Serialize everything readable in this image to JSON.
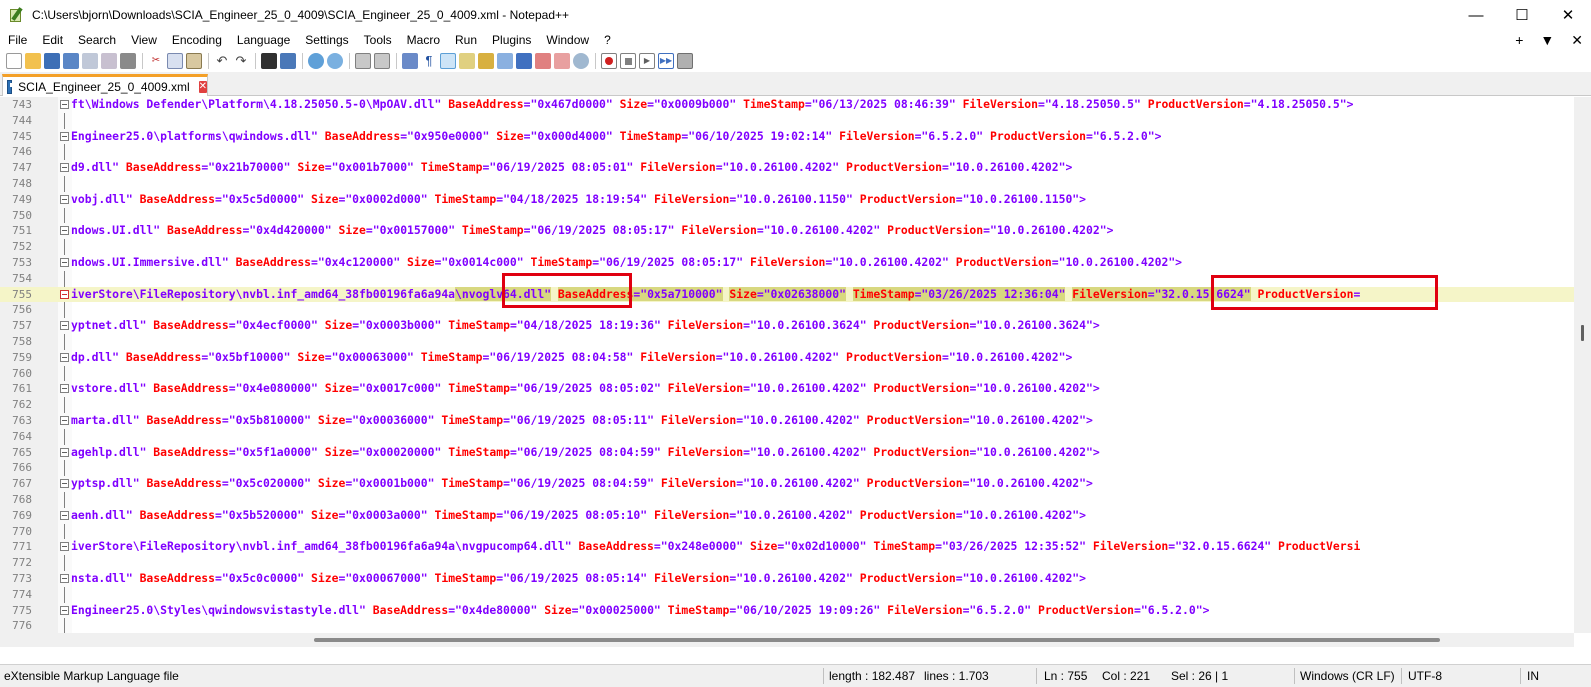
{
  "window": {
    "title": "C:\\Users\\bjorn\\Downloads\\SCIA_Engineer_25_0_4009\\SCIA_Engineer_25_0_4009.xml - Notepad++",
    "minimize": "—",
    "maximize": "☐",
    "close": "✕"
  },
  "menu": {
    "items": [
      "File",
      "Edit",
      "Search",
      "View",
      "Encoding",
      "Language",
      "Settings",
      "Tools",
      "Macro",
      "Run",
      "Plugins",
      "Window",
      "?"
    ],
    "right": [
      "+",
      "▼",
      "✕"
    ]
  },
  "toolbar": {
    "icons": [
      "new-file-icon",
      "open-file-icon",
      "save-icon",
      "save-all-icon",
      "close-icon",
      "close-all-icon",
      "print-icon",
      "cut-icon",
      "copy-icon",
      "paste-icon",
      "undo-icon",
      "redo-icon",
      "find-icon",
      "replace-icon",
      "zoom-in-icon",
      "zoom-out-icon",
      "sync-vertical-icon",
      "sync-horizontal-icon",
      "word-wrap-icon",
      "show-all-chars-icon",
      "indent-guide-icon",
      "udl-icon",
      "document-map-icon",
      "function-list-icon",
      "folder-workspace-icon",
      "monitoring-icon",
      "record-macro-icon",
      "stop-macro-icon",
      "play-macro-icon",
      "run-macro-multiple-icon",
      "save-macro-icon"
    ],
    "colors": {
      "active_bg": "#cde4f7"
    }
  },
  "tab": {
    "label": "SCIA_Engineer_25_0_4009.xml",
    "accent": "#f4a028"
  },
  "editor": {
    "lines": [
      {
        "n": "743",
        "parts": [
          [
            "v",
            "ft\\Windows Defender\\Platform\\4.18.25050.5-0\\MpOAV.dll\" "
          ],
          [
            "a",
            "BaseAddress"
          ],
          [
            "v",
            "=\"0x467d0000\" "
          ],
          [
            "a",
            "Size"
          ],
          [
            "v",
            "=\"0x0009b000\" "
          ],
          [
            "a",
            "TimeStamp"
          ],
          [
            "v",
            "=\"06/13/2025 08:46:39\" "
          ],
          [
            "a",
            "FileVersion"
          ],
          [
            "v",
            "=\"4.18.25050.5\" "
          ],
          [
            "a",
            "ProductVersion"
          ],
          [
            "v",
            "=\"4.18.25050.5\">"
          ]
        ]
      },
      {
        "n": "744",
        "parts": []
      },
      {
        "n": "745",
        "parts": [
          [
            "v",
            "Engineer25.0\\platforms\\qwindows.dll\" "
          ],
          [
            "a",
            "BaseAddress"
          ],
          [
            "v",
            "=\"0x950e0000\" "
          ],
          [
            "a",
            "Size"
          ],
          [
            "v",
            "=\"0x000d4000\" "
          ],
          [
            "a",
            "TimeStamp"
          ],
          [
            "v",
            "=\"06/10/2025 19:02:14\" "
          ],
          [
            "a",
            "FileVersion"
          ],
          [
            "v",
            "=\"6.5.2.0\" "
          ],
          [
            "a",
            "ProductVersion"
          ],
          [
            "v",
            "=\"6.5.2.0\">"
          ]
        ]
      },
      {
        "n": "746",
        "parts": []
      },
      {
        "n": "747",
        "parts": [
          [
            "v",
            "d9.dll\" "
          ],
          [
            "a",
            "BaseAddress"
          ],
          [
            "v",
            "=\"0x21b70000\" "
          ],
          [
            "a",
            "Size"
          ],
          [
            "v",
            "=\"0x001b7000\" "
          ],
          [
            "a",
            "TimeStamp"
          ],
          [
            "v",
            "=\"06/19/2025 08:05:01\" "
          ],
          [
            "a",
            "FileVersion"
          ],
          [
            "v",
            "=\"10.0.26100.4202\" "
          ],
          [
            "a",
            "ProductVersion"
          ],
          [
            "v",
            "=\"10.0.26100.4202\">"
          ]
        ]
      },
      {
        "n": "748",
        "parts": []
      },
      {
        "n": "749",
        "parts": [
          [
            "v",
            "vobj.dll\" "
          ],
          [
            "a",
            "BaseAddress"
          ],
          [
            "v",
            "=\"0x5c5d0000\" "
          ],
          [
            "a",
            "Size"
          ],
          [
            "v",
            "=\"0x0002d000\" "
          ],
          [
            "a",
            "TimeStamp"
          ],
          [
            "v",
            "=\"04/18/2025 18:19:54\" "
          ],
          [
            "a",
            "FileVersion"
          ],
          [
            "v",
            "=\"10.0.26100.1150\" "
          ],
          [
            "a",
            "ProductVersion"
          ],
          [
            "v",
            "=\"10.0.26100.1150\">"
          ]
        ]
      },
      {
        "n": "750",
        "parts": []
      },
      {
        "n": "751",
        "parts": [
          [
            "v",
            "ndows.UI.dll\" "
          ],
          [
            "a",
            "BaseAddress"
          ],
          [
            "v",
            "=\"0x4d420000\" "
          ],
          [
            "a",
            "Size"
          ],
          [
            "v",
            "=\"0x00157000\" "
          ],
          [
            "a",
            "TimeStamp"
          ],
          [
            "v",
            "=\"06/19/2025 08:05:17\" "
          ],
          [
            "a",
            "FileVersion"
          ],
          [
            "v",
            "=\"10.0.26100.4202\" "
          ],
          [
            "a",
            "ProductVersion"
          ],
          [
            "v",
            "=\"10.0.26100.4202\">"
          ]
        ]
      },
      {
        "n": "752",
        "parts": []
      },
      {
        "n": "753",
        "parts": [
          [
            "v",
            "ndows.UI.Immersive.dll\" "
          ],
          [
            "a",
            "BaseAddress"
          ],
          [
            "v",
            "=\"0x4c120000\" "
          ],
          [
            "a",
            "Size"
          ],
          [
            "v",
            "=\"0x0014c000\" "
          ],
          [
            "a",
            "TimeStamp"
          ],
          [
            "v",
            "=\"06/19/2025 08:05:17\" "
          ],
          [
            "a",
            "FileVersion"
          ],
          [
            "v",
            "=\"10.0.26100.4202\" "
          ],
          [
            "a",
            "ProductVersion"
          ],
          [
            "v",
            "=\"10.0.26100.4202\">"
          ]
        ]
      },
      {
        "n": "754",
        "parts": []
      },
      {
        "n": "755",
        "current": true,
        "parts": [
          [
            "v",
            "iverStore\\FileRepository\\nvbl.inf_amd64_38fb00196fa6a94a"
          ],
          [
            "vh",
            "\\nvoglv64.dll\""
          ],
          [
            "v",
            " "
          ],
          [
            "ah",
            "BaseAddress"
          ],
          [
            "vh",
            "=\"0x5a710000\""
          ],
          [
            "v",
            " "
          ],
          [
            "ah",
            "Size"
          ],
          [
            "vh",
            "=\"0x02638000\""
          ],
          [
            "v",
            " "
          ],
          [
            "ah",
            "TimeStamp"
          ],
          [
            "vh",
            "=\"03/26/2025 12:36:04\""
          ],
          [
            "v",
            " "
          ],
          [
            "ah",
            "FileVersion"
          ],
          [
            "vh",
            "=\"32.0.15.6624\""
          ],
          [
            "v",
            " "
          ],
          [
            "a",
            "ProductVersion"
          ],
          [
            "v",
            "="
          ]
        ]
      },
      {
        "n": "756",
        "parts": []
      },
      {
        "n": "757",
        "parts": [
          [
            "v",
            "yptnet.dll\" "
          ],
          [
            "a",
            "BaseAddress"
          ],
          [
            "v",
            "=\"0x4ecf0000\" "
          ],
          [
            "a",
            "Size"
          ],
          [
            "v",
            "=\"0x0003b000\" "
          ],
          [
            "a",
            "TimeStamp"
          ],
          [
            "v",
            "=\"04/18/2025 18:19:36\" "
          ],
          [
            "a",
            "FileVersion"
          ],
          [
            "v",
            "=\"10.0.26100.3624\" "
          ],
          [
            "a",
            "ProductVersion"
          ],
          [
            "v",
            "=\"10.0.26100.3624\">"
          ]
        ]
      },
      {
        "n": "758",
        "parts": []
      },
      {
        "n": "759",
        "parts": [
          [
            "v",
            "dp.dll\" "
          ],
          [
            "a",
            "BaseAddress"
          ],
          [
            "v",
            "=\"0x5bf10000\" "
          ],
          [
            "a",
            "Size"
          ],
          [
            "v",
            "=\"0x00063000\" "
          ],
          [
            "a",
            "TimeStamp"
          ],
          [
            "v",
            "=\"06/19/2025 08:04:58\" "
          ],
          [
            "a",
            "FileVersion"
          ],
          [
            "v",
            "=\"10.0.26100.4202\" "
          ],
          [
            "a",
            "ProductVersion"
          ],
          [
            "v",
            "=\"10.0.26100.4202\">"
          ]
        ]
      },
      {
        "n": "760",
        "parts": []
      },
      {
        "n": "761",
        "parts": [
          [
            "v",
            "vstore.dll\" "
          ],
          [
            "a",
            "BaseAddress"
          ],
          [
            "v",
            "=\"0x4e080000\" "
          ],
          [
            "a",
            "Size"
          ],
          [
            "v",
            "=\"0x0017c000\" "
          ],
          [
            "a",
            "TimeStamp"
          ],
          [
            "v",
            "=\"06/19/2025 08:05:02\" "
          ],
          [
            "a",
            "FileVersion"
          ],
          [
            "v",
            "=\"10.0.26100.4202\" "
          ],
          [
            "a",
            "ProductVersion"
          ],
          [
            "v",
            "=\"10.0.26100.4202\">"
          ]
        ]
      },
      {
        "n": "762",
        "parts": []
      },
      {
        "n": "763",
        "parts": [
          [
            "v",
            "marta.dll\" "
          ],
          [
            "a",
            "BaseAddress"
          ],
          [
            "v",
            "=\"0x5b810000\" "
          ],
          [
            "a",
            "Size"
          ],
          [
            "v",
            "=\"0x00036000\" "
          ],
          [
            "a",
            "TimeStamp"
          ],
          [
            "v",
            "=\"06/19/2025 08:05:11\" "
          ],
          [
            "a",
            "FileVersion"
          ],
          [
            "v",
            "=\"10.0.26100.4202\" "
          ],
          [
            "a",
            "ProductVersion"
          ],
          [
            "v",
            "=\"10.0.26100.4202\">"
          ]
        ]
      },
      {
        "n": "764",
        "parts": []
      },
      {
        "n": "765",
        "parts": [
          [
            "v",
            "agehlp.dll\" "
          ],
          [
            "a",
            "BaseAddress"
          ],
          [
            "v",
            "=\"0x5f1a0000\" "
          ],
          [
            "a",
            "Size"
          ],
          [
            "v",
            "=\"0x00020000\" "
          ],
          [
            "a",
            "TimeStamp"
          ],
          [
            "v",
            "=\"06/19/2025 08:04:59\" "
          ],
          [
            "a",
            "FileVersion"
          ],
          [
            "v",
            "=\"10.0.26100.4202\" "
          ],
          [
            "a",
            "ProductVersion"
          ],
          [
            "v",
            "=\"10.0.26100.4202\">"
          ]
        ]
      },
      {
        "n": "766",
        "parts": []
      },
      {
        "n": "767",
        "parts": [
          [
            "v",
            "yptsp.dll\" "
          ],
          [
            "a",
            "BaseAddress"
          ],
          [
            "v",
            "=\"0x5c020000\" "
          ],
          [
            "a",
            "Size"
          ],
          [
            "v",
            "=\"0x0001b000\" "
          ],
          [
            "a",
            "TimeStamp"
          ],
          [
            "v",
            "=\"06/19/2025 08:04:59\" "
          ],
          [
            "a",
            "FileVersion"
          ],
          [
            "v",
            "=\"10.0.26100.4202\" "
          ],
          [
            "a",
            "ProductVersion"
          ],
          [
            "v",
            "=\"10.0.26100.4202\">"
          ]
        ]
      },
      {
        "n": "768",
        "parts": []
      },
      {
        "n": "769",
        "parts": [
          [
            "v",
            "aenh.dll\" "
          ],
          [
            "a",
            "BaseAddress"
          ],
          [
            "v",
            "=\"0x5b520000\" "
          ],
          [
            "a",
            "Size"
          ],
          [
            "v",
            "=\"0x0003a000\" "
          ],
          [
            "a",
            "TimeStamp"
          ],
          [
            "v",
            "=\"06/19/2025 08:05:10\" "
          ],
          [
            "a",
            "FileVersion"
          ],
          [
            "v",
            "=\"10.0.26100.4202\" "
          ],
          [
            "a",
            "ProductVersion"
          ],
          [
            "v",
            "=\"10.0.26100.4202\">"
          ]
        ]
      },
      {
        "n": "770",
        "parts": []
      },
      {
        "n": "771",
        "parts": [
          [
            "v",
            "iverStore\\FileRepository\\nvbl.inf_amd64_38fb00196fa6a94a\\nvgpucomp64.dll\" "
          ],
          [
            "a",
            "BaseAddress"
          ],
          [
            "v",
            "=\"0x248e0000\" "
          ],
          [
            "a",
            "Size"
          ],
          [
            "v",
            "=\"0x02d10000\" "
          ],
          [
            "a",
            "TimeStamp"
          ],
          [
            "v",
            "=\"03/26/2025 12:35:52\" "
          ],
          [
            "a",
            "FileVersion"
          ],
          [
            "v",
            "=\"32.0.15.6624\" "
          ],
          [
            "a",
            "ProductVersi"
          ]
        ]
      },
      {
        "n": "772",
        "parts": []
      },
      {
        "n": "773",
        "parts": [
          [
            "v",
            "nsta.dll\" "
          ],
          [
            "a",
            "BaseAddress"
          ],
          [
            "v",
            "=\"0x5c0c0000\" "
          ],
          [
            "a",
            "Size"
          ],
          [
            "v",
            "=\"0x00067000\" "
          ],
          [
            "a",
            "TimeStamp"
          ],
          [
            "v",
            "=\"06/19/2025 08:05:14\" "
          ],
          [
            "a",
            "FileVersion"
          ],
          [
            "v",
            "=\"10.0.26100.4202\" "
          ],
          [
            "a",
            "ProductVersion"
          ],
          [
            "v",
            "=\"10.0.26100.4202\">"
          ]
        ]
      },
      {
        "n": "774",
        "parts": []
      },
      {
        "n": "775",
        "parts": [
          [
            "v",
            "Engineer25.0\\Styles\\qwindowsvistastyle.dll\" "
          ],
          [
            "a",
            "BaseAddress"
          ],
          [
            "v",
            "=\"0x4de80000\" "
          ],
          [
            "a",
            "Size"
          ],
          [
            "v",
            "=\"0x00025000\" "
          ],
          [
            "a",
            "TimeStamp"
          ],
          [
            "v",
            "=\"06/10/2025 19:09:26\" "
          ],
          [
            "a",
            "FileVersion"
          ],
          [
            "v",
            "=\"6.5.2.0\" "
          ],
          [
            "a",
            "ProductVersion"
          ],
          [
            "v",
            "=\"6.5.2.0\">"
          ]
        ]
      },
      {
        "n": "776",
        "parts": []
      }
    ],
    "colors": {
      "attr": "#ff0000",
      "value": "#8000ff",
      "current_line": "#f5f5c8",
      "highlight": "#d8d880",
      "annotation": "#e00010"
    }
  },
  "status": {
    "filetype": "eXtensible Markup Language file",
    "length": "length : 182.487",
    "lines": "lines : 1.703",
    "ln": "Ln : 755",
    "col": "Col : 221",
    "sel": "Sel : 26 | 1",
    "eol": "Windows (CR LF)",
    "encoding": "UTF-8",
    "mode": "IN"
  }
}
